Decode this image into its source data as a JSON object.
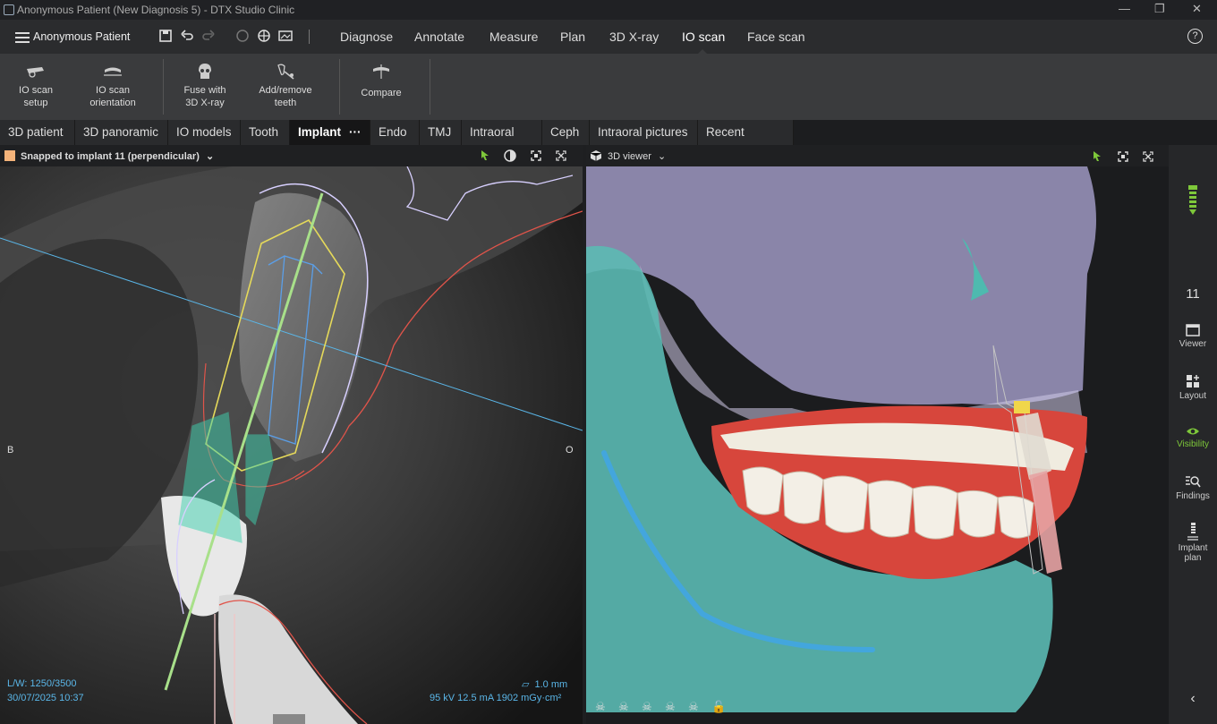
{
  "window": {
    "title": "Anonymous Patient (New Diagnosis 5) - DTX Studio Clinic",
    "controls": [
      "—",
      "❐",
      "✕"
    ]
  },
  "nav": {
    "patient_name": "Anonymous Patient",
    "tabs": [
      "Diagnose",
      "Annotate",
      "Measure",
      "Plan",
      "3D X-ray",
      "IO scan",
      "Face scan"
    ],
    "active_tab": "IO scan",
    "help": "?"
  },
  "toolbar": {
    "io_scan_setup": "IO scan setup",
    "io_scan_orientation": "IO scan orientation",
    "fuse_with_3d_xray": "Fuse with 3D X-ray",
    "add_remove_teeth": "Add/remove teeth",
    "compare": "Compare"
  },
  "view_tabs": {
    "items": [
      "3D patient",
      "3D panoramic",
      "IO models",
      "Tooth",
      "Implant",
      "Endo",
      "TMJ",
      "Intraoral RX",
      "Ceph",
      "Intraoral pictures",
      "Recent images"
    ],
    "active": "Implant",
    "more": "···"
  },
  "left_view": {
    "mode": "Snapped to implant 11 (perpendicular)",
    "side_left": "B",
    "side_right": "O",
    "lw": "L/W: 1250/3500",
    "datetime": "30/07/2025 10:37",
    "slice_thickness": "1.0 mm",
    "exposure": "95 kV  12.5 mA  1902 mGy·cm²"
  },
  "right_view": {
    "title": "3D viewer"
  },
  "sidebar": {
    "implant_number": "11",
    "viewer": "Viewer",
    "layout": "Layout",
    "visibility": "Visibility",
    "findings": "Findings",
    "implant_plan": "Implant plan"
  },
  "colors": {
    "accent_green": "#7ec83a",
    "hud_blue": "#5ab6e8",
    "bg_dark": "#1e1f21"
  }
}
